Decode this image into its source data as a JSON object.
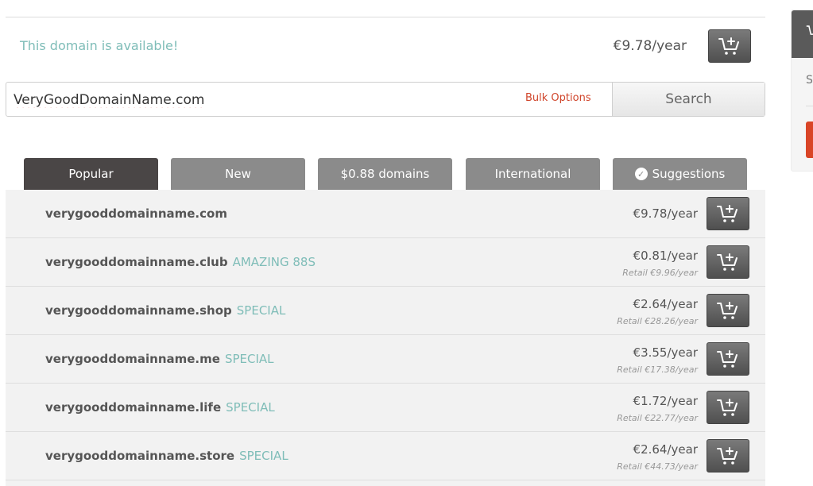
{
  "availability": {
    "message": "This domain is available!",
    "price": "€9.78/year"
  },
  "search": {
    "query": "VeryGoodDomainName.com",
    "bulk_options_label": "Bulk Options",
    "button_label": "Search"
  },
  "tabs": [
    {
      "label": "Popular",
      "active": true
    },
    {
      "label": "New",
      "active": false
    },
    {
      "label": "$0.88 domains",
      "active": false
    },
    {
      "label": "International",
      "active": false
    },
    {
      "label": "Suggestions",
      "active": false,
      "icon": "check-circle-icon"
    }
  ],
  "results": [
    {
      "domain": "verygooddomainname.com",
      "tag": "",
      "price": "€9.78/year",
      "retail": ""
    },
    {
      "domain": "verygooddomainname.club",
      "tag": "AMAZING 88S",
      "price": "€0.81/year",
      "retail": "Retail €9.96/year"
    },
    {
      "domain": "verygooddomainname.shop",
      "tag": "SPECIAL",
      "price": "€2.64/year",
      "retail": "Retail €28.26/year"
    },
    {
      "domain": "verygooddomainname.me",
      "tag": "SPECIAL",
      "price": "€3.55/year",
      "retail": "Retail €17.38/year"
    },
    {
      "domain": "verygooddomainname.life",
      "tag": "SPECIAL",
      "price": "€1.72/year",
      "retail": "Retail €22.77/year"
    },
    {
      "domain": "verygooddomainname.store",
      "tag": "SPECIAL",
      "price": "€2.64/year",
      "retail": "Retail €44.73/year"
    }
  ],
  "side_panel": {
    "text": "S"
  },
  "colors": {
    "accent_teal": "#7fbdb8",
    "accent_red": "#d0452b",
    "active_tab": "#4a4646",
    "inactive_tab": "#8b8b8b",
    "cart_button": "#5f5f5f"
  }
}
